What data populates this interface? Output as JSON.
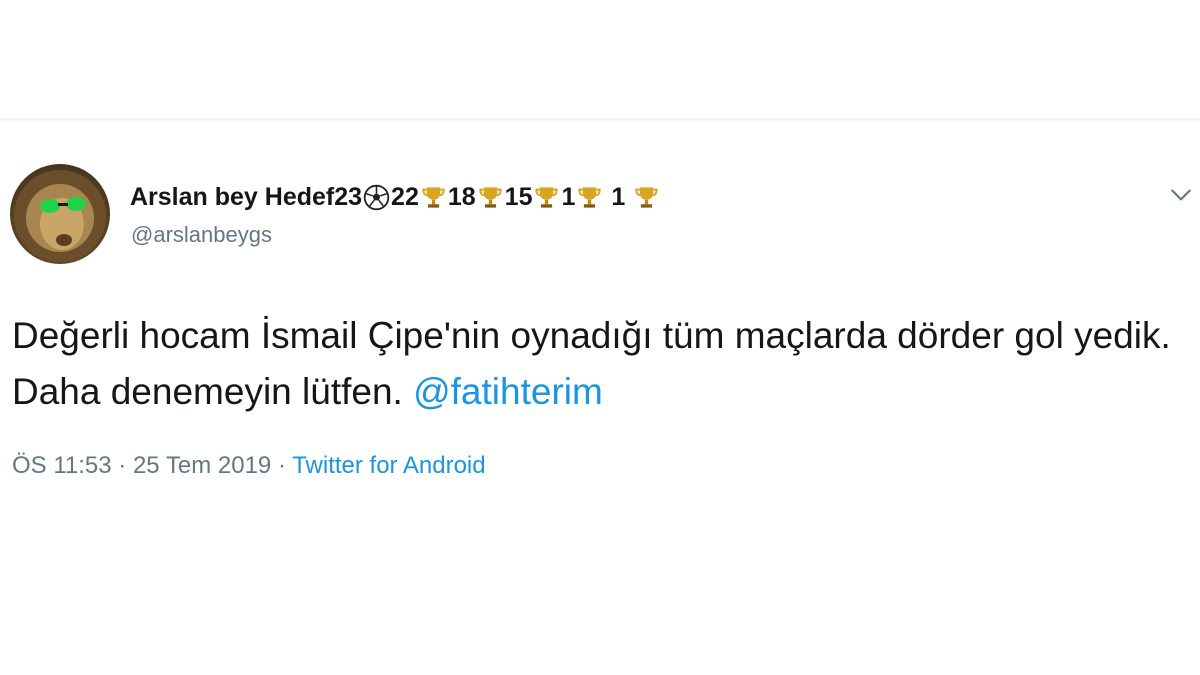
{
  "tweet": {
    "display_name_prefix": "Arslan bey Hedef23",
    "display_name_parts": [
      "22",
      "18",
      "15",
      "1",
      " 1 "
    ],
    "handle": "@arslanbeygs",
    "text_main": "Değerli hocam İsmail Çipe'nin oynadığı tüm maçlarda dörder gol yedik. Daha denemeyin lütfen. ",
    "mention": "@fatihterim",
    "time": "ÖS 11:53",
    "separator": " · ",
    "date": "25 Tem 2019",
    "separator2": " · ",
    "source": "Twitter for Android"
  },
  "icons": {
    "ball": "soccer-ball-icon",
    "trophy": "trophy-icon",
    "caret": "chevron-down-icon",
    "avatar": "lion-avatar"
  },
  "colors": {
    "text": "#14171a",
    "secondary": "#657786",
    "link": "#1b95e0",
    "trophy": "#d9a520"
  }
}
